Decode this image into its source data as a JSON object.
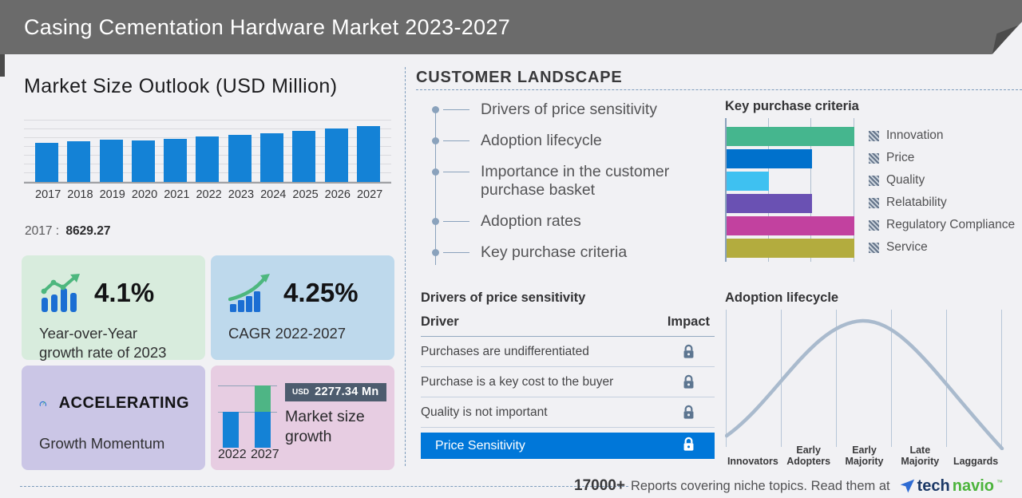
{
  "header": {
    "title": "Casing Cementation Hardware Market 2023-2027"
  },
  "market_outlook": {
    "title": "Market Size Outlook (USD Million)",
    "anchor_year": "2017",
    "anchor_sep": ":",
    "anchor_value": "8629.27"
  },
  "chart_data": [
    {
      "id": "market_size_outlook",
      "type": "bar",
      "title": "Market Size Outlook (USD Million)",
      "categories": [
        "2017",
        "2018",
        "2019",
        "2020",
        "2021",
        "2022",
        "2023",
        "2024",
        "2025",
        "2026",
        "2027"
      ],
      "values": [
        8629.27,
        9030,
        9390,
        9160,
        9630,
        10090,
        10450,
        10800,
        11330,
        11860,
        12330
      ],
      "note": "only 2017 value labeled on screen (8629.27); other values estimated from bar heights",
      "ylabel": "USD Million",
      "bar_color": "#1482d6",
      "grid": true
    },
    {
      "id": "key_purchase_criteria",
      "type": "bar",
      "orientation": "horizontal",
      "title": "Key purchase criteria",
      "categories": [
        "Innovation",
        "Price",
        "Quality",
        "Relatability",
        "Regulatory Compliance",
        "Service"
      ],
      "values": [
        100,
        67,
        33,
        67,
        100,
        100
      ],
      "xlim": [
        0,
        100
      ],
      "colors": [
        "#45b68e",
        "#0071cc",
        "#3ec1f1",
        "#6a51b3",
        "#c2419f",
        "#b3ac3e"
      ],
      "legend_position": "right"
    },
    {
      "id": "market_size_growth",
      "type": "bar",
      "stacked": true,
      "title": "Market size growth",
      "categories": [
        "2022",
        "2027"
      ],
      "series": [
        {
          "name": "2022 base",
          "values": [
            1,
            1
          ],
          "color": "#1482d6"
        },
        {
          "name": "growth 2022-2027",
          "values": [
            0,
            0.72
          ],
          "color": "#4eb585"
        }
      ],
      "annotation": "USD 2277.34 Mn"
    },
    {
      "id": "adoption_lifecycle",
      "type": "line",
      "shape": "bell curve",
      "title": "Adoption lifecycle",
      "categories": [
        "Innovators",
        "Early Adopters",
        "Early Majority",
        "Late Majority",
        "Laggards"
      ],
      "peak": "Early Majority",
      "line_color": "#a9bacd"
    }
  ],
  "cards": {
    "yoy": {
      "value": "4.1%",
      "label": "Year-over-Year\ngrowth rate of 2023",
      "bg": "#d8ecdd"
    },
    "cagr": {
      "value": "4.25%",
      "label": "CAGR 2022-2027",
      "bg": "#bed9ec"
    },
    "momentum": {
      "value": "ACCELERATING",
      "label": "Growth Momentum",
      "bg": "#cbc6e6"
    },
    "growth": {
      "badge_currency": "USD",
      "badge_value": "2277.34 Mn",
      "label": "Market size growth",
      "year_left": "2022",
      "year_right": "2027",
      "bg": "#e7cde2"
    }
  },
  "customer_landscape": {
    "title": "CUSTOMER LANDSCAPE",
    "items": [
      "Drivers of price sensitivity",
      "Adoption lifecycle",
      "Importance in the customer purchase basket",
      "Adoption rates",
      "Key purchase criteria"
    ]
  },
  "key_purchase": {
    "title": "Key purchase criteria"
  },
  "drivers": {
    "title": "Drivers of price sensitivity",
    "col_driver": "Driver",
    "col_impact": "Impact",
    "rows": [
      "Purchases are undifferentiated",
      "Purchase is a key cost to the buyer",
      "Quality is not important"
    ],
    "highlight": "Price Sensitivity"
  },
  "adoption": {
    "title": "Adoption lifecycle"
  },
  "footer": {
    "count": "17000+",
    "text": "Reports covering niche topics. Read them at",
    "brand_tech": "tech",
    "brand_navio": "navio",
    "brand_tm": "™"
  }
}
